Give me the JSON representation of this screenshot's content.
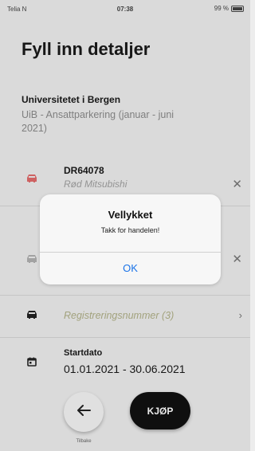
{
  "status_bar": {
    "carrier": "Telia N",
    "time": "07:38",
    "battery": "99 %"
  },
  "page": {
    "title": "Fyll inn detaljer"
  },
  "organization": {
    "name": "Universitetet i Bergen",
    "description": "UiB - Ansattparkering (januar - juni 2021)"
  },
  "vehicles": [
    {
      "plate": "DR64078",
      "description": "Rød Mitsubishi"
    }
  ],
  "registration": {
    "label": "Registreringsnummer (3)"
  },
  "date": {
    "label": "Startdato",
    "value": "01.01.2021 - 30.06.2021"
  },
  "footer": {
    "back_label": "Tilbake",
    "buy_label": "KJØP"
  },
  "alert": {
    "title": "Vellykket",
    "message": "Takk for handelen!",
    "ok_label": "OK"
  },
  "colors": {
    "car_icon_1": "#e06b6b",
    "car_icon_2": "#b0b0b0",
    "accent": "#1a73e8"
  },
  "icons": {
    "vehicle_1": "car-icon",
    "vehicle_2": "car-icon",
    "registration": "car-icon",
    "date": "calendar-icon",
    "back": "arrow-left-icon"
  }
}
